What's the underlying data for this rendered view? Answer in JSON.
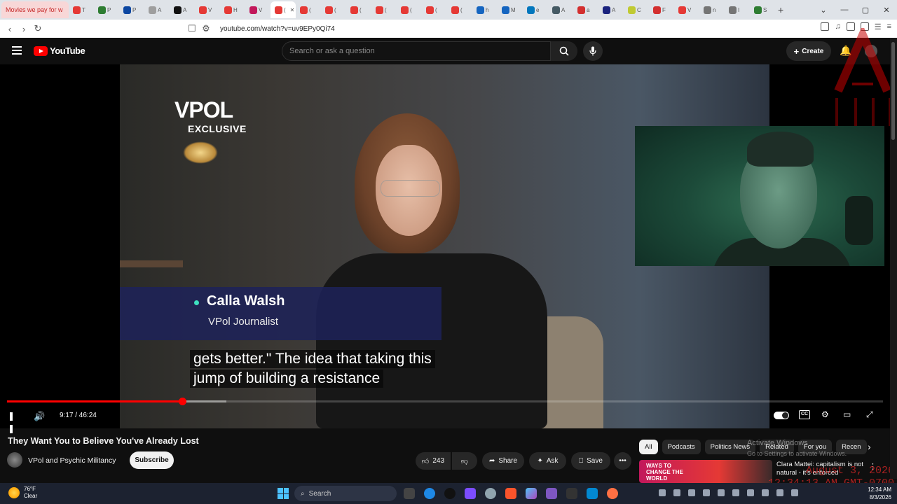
{
  "browser": {
    "first_tab_title": "Movies we pay for w",
    "mini_tabs": [
      {
        "letter": "T",
        "color": "#e53935"
      },
      {
        "letter": "P",
        "color": "#2e7d32"
      },
      {
        "letter": "P",
        "color": "#0d47a1"
      },
      {
        "letter": "A",
        "color": "#9e9e9e"
      },
      {
        "letter": "A",
        "color": "#111111"
      },
      {
        "letter": "V",
        "color": "#e53935"
      },
      {
        "letter": "H",
        "color": "#e53935"
      },
      {
        "letter": "V",
        "color": "#c2185b"
      },
      {
        "letter": "(",
        "color": "#e53935"
      },
      {
        "letter": "(",
        "color": "#e53935"
      },
      {
        "letter": "(",
        "color": "#e53935"
      },
      {
        "letter": "(",
        "color": "#e53935"
      },
      {
        "letter": "(",
        "color": "#e53935"
      },
      {
        "letter": "(",
        "color": "#e53935"
      },
      {
        "letter": "(",
        "color": "#e53935"
      },
      {
        "letter": "(",
        "color": "#e53935"
      },
      {
        "letter": "h",
        "color": "#1565c0"
      },
      {
        "letter": "M",
        "color": "#1565c0"
      },
      {
        "letter": "e",
        "color": "#0277bd"
      },
      {
        "letter": "A",
        "color": "#455a64"
      },
      {
        "letter": "a",
        "color": "#d32f2f"
      },
      {
        "letter": "A",
        "color": "#1a237e"
      },
      {
        "letter": "C",
        "color": "#c0ca33"
      },
      {
        "letter": "F",
        "color": "#d32f2f"
      },
      {
        "letter": "V",
        "color": "#e53935"
      },
      {
        "letter": "n",
        "color": "#757575"
      },
      {
        "letter": "I",
        "color": "#757575"
      },
      {
        "letter": "S",
        "color": "#2e7d32"
      }
    ],
    "url": "youtube.com/watch?v=uv9EPy0Qi74"
  },
  "masthead": {
    "logo_text": "YouTube",
    "search_placeholder": "Search or ask a question",
    "create_label": "Create"
  },
  "video": {
    "brand": "VPOL",
    "brand_sub": "EXCLUSIVE",
    "lower_third_name": "Calla Walsh",
    "lower_third_role": "VPol Journalist",
    "caption_line1": "gets better.\" The idea that taking this",
    "caption_line2": "jump of building a resistance",
    "time": "9:17 / 46:24",
    "played_fraction": 0.2,
    "buffered_fraction": 0.25
  },
  "details": {
    "title": "They Want You to Believe You've Already Lost",
    "channel": "VPol and Psychic Militancy",
    "subscribe_label": "Subscribe",
    "like_count": "243",
    "share_label": "Share",
    "ask_label": "Ask",
    "save_label": "Save"
  },
  "sidebar": {
    "chips": [
      "All",
      "Podcasts",
      "Politics News",
      "Related",
      "For you",
      "Recen"
    ],
    "thumb_text": "WAYS TO CHANGE THE WORLD",
    "rec_title": "Clara Mattei: capitalism is not natural - it's enforced"
  },
  "watermark": {
    "line1": "Activate Windows",
    "line2": "Go to Settings to activate Windows."
  },
  "overlay": {
    "date_line1": "August 3, 2026",
    "date_line2": "12:34:13 AM GMT-0700"
  },
  "taskbar": {
    "temp": "76°F",
    "condition": "Clear",
    "search_label": "Search",
    "clock_time": "12:34 AM",
    "clock_date": "8/3/2026"
  }
}
